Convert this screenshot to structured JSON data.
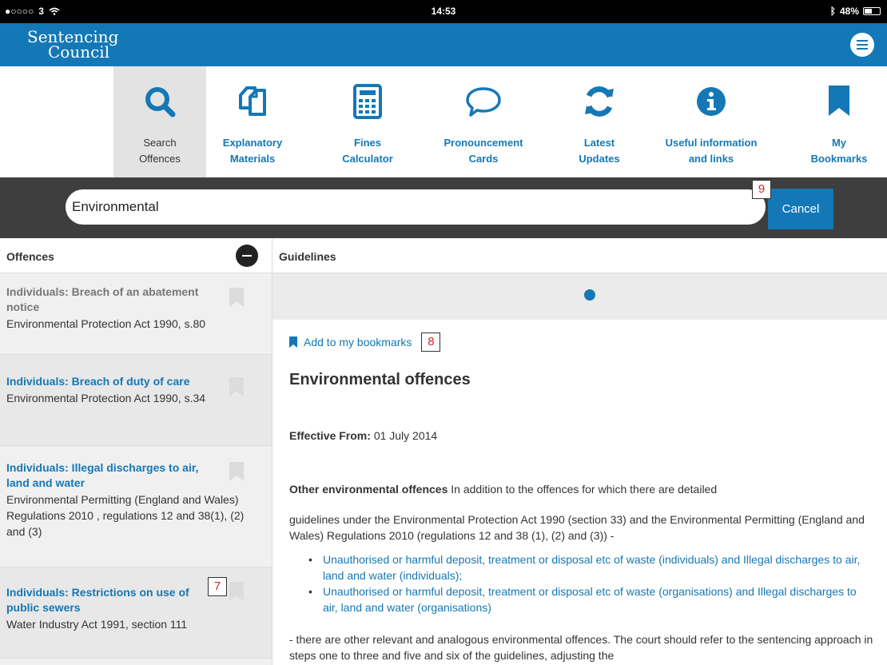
{
  "status_bar": {
    "carrier": "3",
    "time": "14:53",
    "battery": "48%",
    "battery_level": 0.48
  },
  "header": {
    "logo_line1": "Sentencing",
    "logo_line2": "Council",
    "menu_icon": "hamburger-menu-icon"
  },
  "nav": [
    {
      "line1": "Search",
      "line2": "Offences",
      "icon": "search-icon",
      "active": true
    },
    {
      "line1": "Explanatory",
      "line2": "Materials",
      "icon": "documents-icon"
    },
    {
      "line1": "Fines",
      "line2": "Calculator",
      "icon": "calculator-icon"
    },
    {
      "line1": "Pronouncement",
      "line2": "Cards",
      "icon": "speech-bubble-icon"
    },
    {
      "line1": "Latest",
      "line2": "Updates",
      "icon": "refresh-icon"
    },
    {
      "line1": "Useful information",
      "line2": "and links",
      "icon": "info-icon"
    },
    {
      "line1": "My",
      "line2": "Bookmarks",
      "icon": "bookmark-icon"
    }
  ],
  "search": {
    "value": "Environmental",
    "cancel_label": "Cancel"
  },
  "markers": {
    "m7": "7",
    "m8": "8",
    "m9": "9"
  },
  "columns": {
    "offences_header": "Offences",
    "guidelines_header": "Guidelines"
  },
  "offences": [
    {
      "title": "Individuals: Breach of an abatement notice",
      "act": "Environmental Protection Act 1990, s.80",
      "selected": true
    },
    {
      "title": "Individuals: Breach of duty of care",
      "act": "Environmental Protection Act 1990, s.34"
    },
    {
      "title": "Individuals: Illegal discharges to air, land and water",
      "act": "Environmental Permitting (England and Wales) Regulations 2010 , regulations 12 and 38(1), (2) and (3)"
    },
    {
      "title": "Individuals: Restrictions on use of public sewers",
      "act": "Water Industry Act 1991, section 111"
    }
  ],
  "guideline": {
    "add_bookmark": "Add to my bookmarks",
    "title": "Environmental offences",
    "effective_label": "Effective From:",
    "effective_date": "01 July 2014",
    "para1_bold": "Other environmental offences",
    "para1_text": " In addition to the offences for which there are detailed",
    "para2": "guidelines under the Environmental Protection Act 1990 (section 33) and the Environmental Permitting (England and Wales) Regulations 2010 (regulations 12 and 38 (1), (2) and (3)) -",
    "bullets": [
      "Unauthorised or harmful deposit, treatment or disposal etc of waste (individuals) and Illegal discharges to air, land and water (individuals);",
      "Unauthorised or harmful deposit, treatment or disposal etc of waste (organisations) and Illegal discharges to air, land and water (organisations)"
    ],
    "para3": "- there are other relevant and analogous environmental offences. The court should refer to the sentencing approach in steps one to three and five and six of the guidelines, adjusting the"
  },
  "colors": {
    "brand_blue": "#1478b6",
    "dark_bar": "#3e3e3e",
    "list_bg": "#f0f0f0"
  }
}
